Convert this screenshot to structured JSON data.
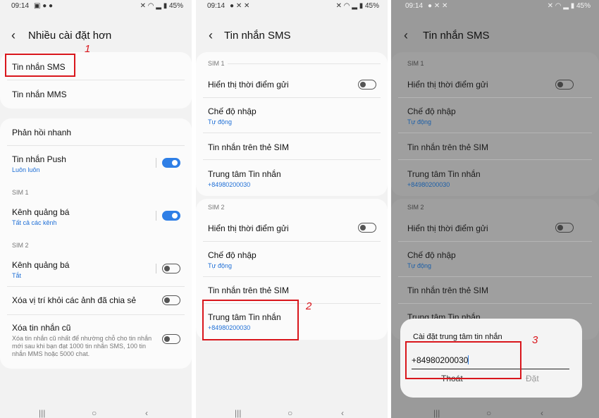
{
  "status": {
    "time": "09:14",
    "battery": "45%",
    "left_icons_p1": "▣ ● ●",
    "left_icons_p2": "● ✕ ✕",
    "right_icons": "✕ ◠ ▂ ▮"
  },
  "panel1": {
    "title": "Nhiều cài đặt hơn",
    "items": {
      "sms": "Tin nhắn SMS",
      "mms": "Tin nhắn MMS",
      "quick": "Phản hồi nhanh",
      "push": "Tin nhắn Push",
      "push_sub": "Luôn luôn",
      "sim1": "SIM 1",
      "broadcast1": "Kênh quảng bá",
      "broadcast1_sub": "Tất cả các kênh",
      "sim2": "SIM 2",
      "broadcast2": "Kênh quảng bá",
      "broadcast2_sub": "Tắt",
      "location": "Xóa vị trí khỏi các ảnh đã chia sẻ",
      "old": "Xóa tin nhắn cũ",
      "old_desc": "Xóa tin nhắn cũ nhất để nhường chỗ cho tin nhắn mới sau khi bạn đạt 1000 tin nhắn SMS, 100 tin nhắn MMS hoặc 5000 chat."
    },
    "annotation": "1"
  },
  "panel2": {
    "title": "Tin nhắn SMS",
    "sim1": "SIM 1",
    "sim2": "SIM 2",
    "show_time": "Hiển thị thời điểm gửi",
    "input_mode": "Chế độ nhập",
    "input_mode_sub": "Tự động",
    "sim_messages": "Tin nhắn trên thẻ SIM",
    "center": "Trung tâm Tin nhắn",
    "center_number": "+84980200030",
    "annotation": "2"
  },
  "panel3": {
    "dialog_title": "Cài đặt trung tâm tin nhắn",
    "field_value": "+84980200030",
    "exit": "Thoát",
    "set": "Đặt",
    "annotation": "3"
  },
  "navbar": {
    "recent": "|||",
    "home": "○",
    "back": "‹"
  },
  "colors": {
    "accent": "#2f7fe6",
    "annotation_red": "#d9161c",
    "link_blue": "#1f6fd6"
  }
}
